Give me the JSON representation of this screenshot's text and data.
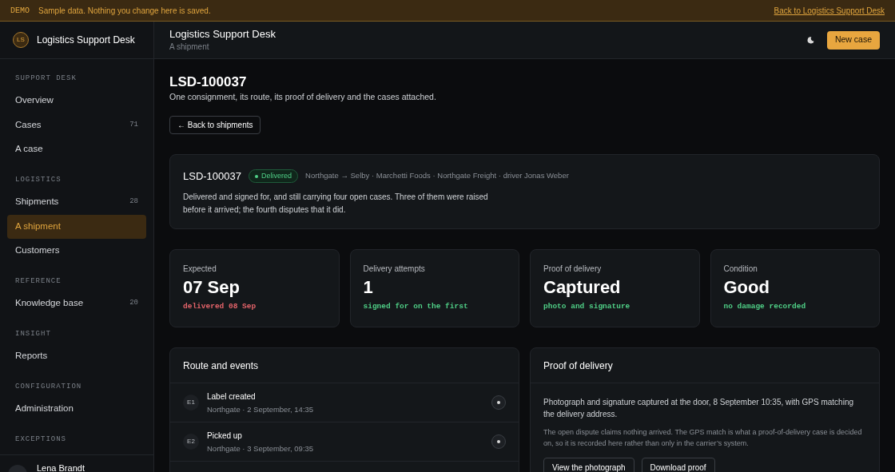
{
  "banner": {
    "tag": "DEMO",
    "message": "Sample data. Nothing you change here is saved.",
    "link": "Back to Logistics Support Desk"
  },
  "brand": {
    "initials": "LS",
    "name": "Logistics Support Desk"
  },
  "sidebar": {
    "sections": [
      {
        "title": "SUPPORT DESK",
        "items": [
          {
            "label": "Overview",
            "selected": false
          },
          {
            "label": "Cases",
            "count": "71",
            "selected": false
          },
          {
            "label": "A case",
            "selected": false
          }
        ]
      },
      {
        "title": "LOGISTICS",
        "items": [
          {
            "label": "Shipments",
            "count": "28",
            "selected": false
          },
          {
            "label": "A shipment",
            "selected": true
          },
          {
            "label": "Customers",
            "selected": false
          }
        ]
      },
      {
        "title": "REFERENCE",
        "items": [
          {
            "label": "Knowledge base",
            "count": "20",
            "selected": false
          }
        ]
      },
      {
        "title": "INSIGHT",
        "items": [
          {
            "label": "Reports",
            "selected": false
          }
        ]
      },
      {
        "title": "CONFIGURATION",
        "items": [
          {
            "label": "Administration",
            "selected": false
          }
        ]
      },
      {
        "title": "EXCEPTIONS"
      }
    ],
    "user": {
      "name": "Lena Brandt"
    }
  },
  "header": {
    "title": "Logistics Support Desk",
    "subtitle": "A shipment",
    "button": "New case"
  },
  "page": {
    "title": "LSD-100037",
    "subtitle": "One consignment, its route, its proof of delivery and the cases attached.",
    "back": "← Back to shipments"
  },
  "summary": {
    "id": "LSD-100037",
    "status": "Delivered",
    "meta": "Northgate → Selby · Marchetti Foods · Northgate Freight · driver Jonas Weber",
    "text": "Delivered and signed for, and still carrying four open cases. Three of them were raised before it arrived; the fourth disputes that it did."
  },
  "stats": [
    {
      "label": "Expected",
      "value": "07 Sep",
      "note": "delivered 08 Sep",
      "color": "#e5646a"
    },
    {
      "label": "Delivery attempts",
      "value": "1",
      "note": "signed for on the first",
      "color": "#4fcf86"
    },
    {
      "label": "Proof of delivery",
      "value": "Captured",
      "note": "photo and signature",
      "color": "#4fcf86"
    },
    {
      "label": "Condition",
      "value": "Good",
      "note": "no damage recorded",
      "color": "#4fcf86"
    }
  ],
  "route": {
    "title": "Route and events",
    "events": [
      {
        "code": "E1",
        "title": "Label created",
        "meta": "Northgate · 2 September, 14:35"
      },
      {
        "code": "E2",
        "title": "Picked up",
        "meta": "Northgate · 3 September, 09:35"
      }
    ]
  },
  "proof": {
    "title": "Proof of delivery",
    "text": "Photograph and signature captured at the door, 8 September 10:35, with GPS matching the delivery address.",
    "note": "The open dispute claims nothing arrived. The GPS match is what a proof-of-delivery case is decided on, so it is recorded here rather than only in the carrier’s system.",
    "buttons": [
      "View the photograph",
      "Download proof"
    ]
  }
}
